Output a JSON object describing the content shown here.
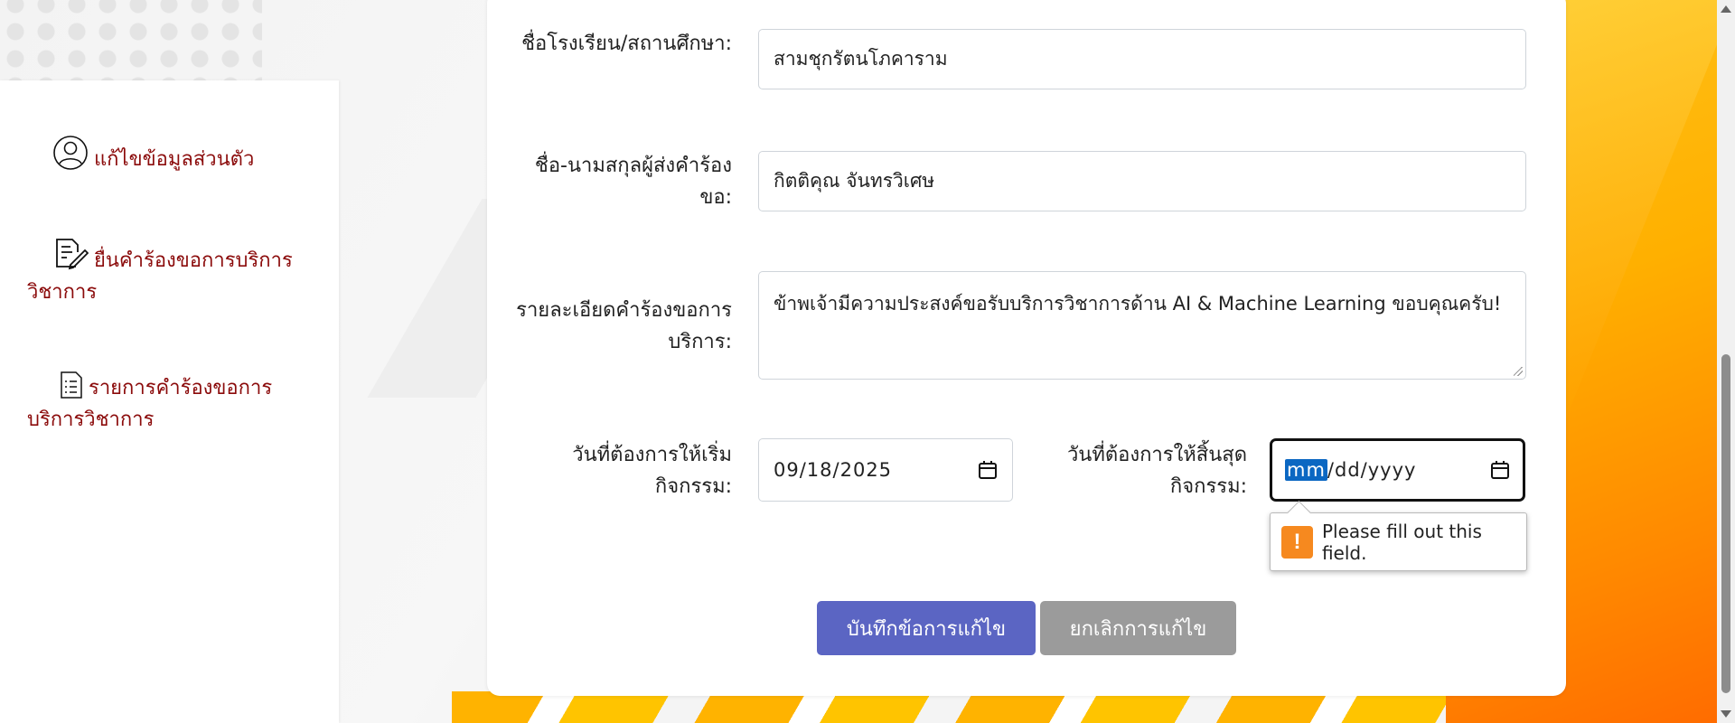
{
  "sidebar": {
    "items": [
      {
        "label": "แก้ไขข้อมูลส่วนตัว",
        "icon": "user-circle-icon"
      },
      {
        "label": "ยื่นคำร้องขอการบริการวิชาการ",
        "icon": "edit-document-icon"
      },
      {
        "label": "รายการคำร้องขอการบริการวิชาการ",
        "icon": "list-document-icon"
      }
    ]
  },
  "form": {
    "school_label": "ชื่อโรงเรียน/สถานศึกษา:",
    "school_value": "สามชุกรัตนโภคาราม",
    "requester_label": "ชื่อ-นามสกุลผู้ส่งคำร้องขอ:",
    "requester_value": "กิตติคุณ จันทรวิเศษ",
    "details_label": "รายละเอียดคำร้องขอการบริการ:",
    "details_value": "ข้าพเจ้ามีความประสงค์ขอรับบริการวิชาการด้าน AI & Machine Learning  ขอบคุณครับ!",
    "start_label": "วันที่ต้องการให้เริ่มกิจกรรม:",
    "start_value": "09/18/2025",
    "end_label": "วันที่ต้องการให้สิ้นสุดกิจกรรม:",
    "end_placeholder_mm": "mm",
    "end_placeholder_rest": "/dd/yyyy",
    "validation_message": "Please fill out this field.",
    "validation_icon": "!"
  },
  "buttons": {
    "save": "บันทึกข้อการแก้ไข",
    "cancel": "ยกเลิกการแก้ไข"
  },
  "colors": {
    "sidebar_link": "#8b0b0b",
    "save_button": "#5b65c3",
    "cancel_button": "#9b9b9b",
    "warning": "#f6891f",
    "accent_background": "#ffb000"
  }
}
